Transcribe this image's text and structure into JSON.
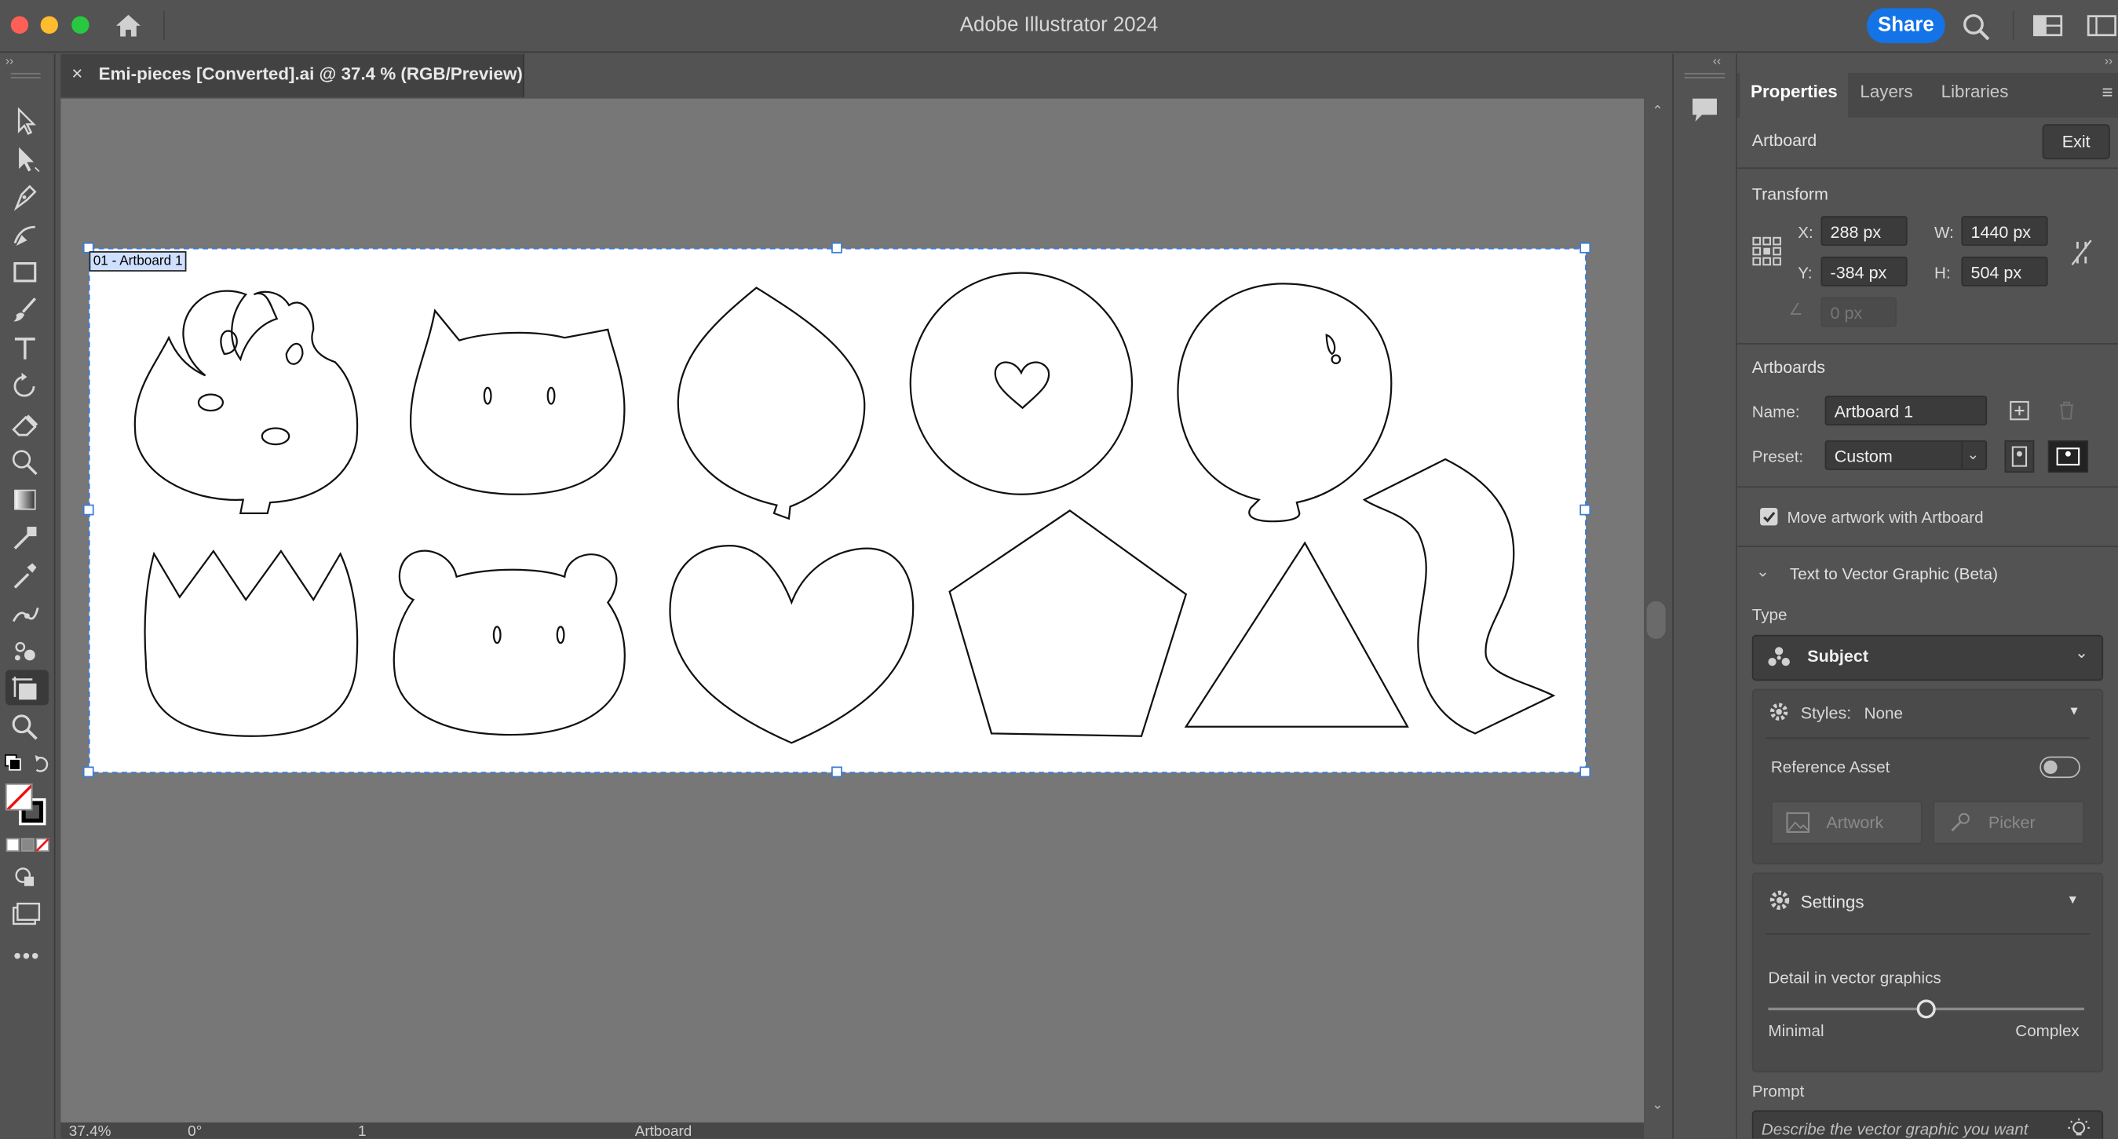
{
  "app": {
    "title": "Adobe Illustrator 2024",
    "share_label": "Share",
    "traffic_colors": [
      "#ff5f57",
      "#febc2e",
      "#28c840"
    ]
  },
  "document": {
    "tab_label": "Emi-pieces [Converted].ai @ 37.4 % (RGB/Preview)",
    "artboard_label": "01 - Artboard 1"
  },
  "status": {
    "zoom": "37.4%",
    "rotation": "0°",
    "page": "1",
    "mode": "Artboard"
  },
  "panel": {
    "tabs": [
      "Properties",
      "Layers",
      "Libraries"
    ],
    "context": "Artboard",
    "exit_label": "Exit",
    "transform": {
      "title": "Transform",
      "x_label": "X:",
      "x": "288 px",
      "y_label": "Y:",
      "y": "-384 px",
      "w_label": "W:",
      "w": "1440 px",
      "h_label": "H:",
      "h": "504 px",
      "angle": "0 px"
    },
    "artboards": {
      "title": "Artboards",
      "name_label": "Name:",
      "name": "Artboard 1",
      "preset_label": "Preset:",
      "preset": "Custom"
    },
    "move_artwork": "Move artwork with Artboard",
    "t2v": {
      "title": "Text to Vector Graphic (Beta)",
      "type_label": "Type",
      "type_value": "Subject",
      "styles_label": "Styles:",
      "styles_value": "None",
      "reference_asset": "Reference Asset",
      "artwork_btn": "Artwork",
      "picker_btn": "Picker",
      "settings": "Settings",
      "detail_label": "Detail in vector graphics",
      "detail_value": 0.5,
      "min_label": "Minimal",
      "max_label": "Complex",
      "prompt_label": "Prompt",
      "prompt_placeholder": "Describe the vector graphic you want"
    }
  }
}
